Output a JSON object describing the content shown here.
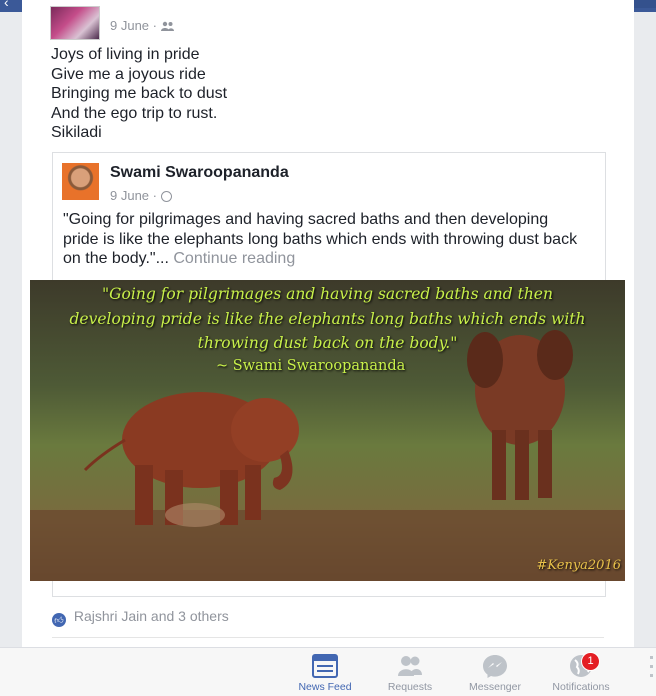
{
  "post": {
    "date": "9 June",
    "separator": "·",
    "lines": [
      "Joys of living in pride",
      "Give me a joyous ride",
      "Bringing me back to dust",
      "And the ego trip to rust.",
      "Sikiladi"
    ],
    "privacy_icon": "friends-icon"
  },
  "shared": {
    "author": "Swami Swaroopananda",
    "date": "9 June",
    "separator": "·",
    "privacy_icon": "globe-icon",
    "quote": "\"Going for pilgrimages and having sacred baths and then developing pride is like the elephants long baths which ends with throwing dust back on the body.\"...",
    "continue_label": "Continue reading"
  },
  "photo": {
    "quote_lines": [
      "\"Going for pilgrimages and having sacred baths and then",
      "developing pride is like the elephants long baths which ends with",
      "throwing dust back on the body.\""
    ],
    "author": "~ Swami Swaroopananda",
    "watermark": "#Kenya2016"
  },
  "reactions": {
    "text": "Rajshri Jain and 3 others",
    "icon": "like-icon"
  },
  "tabbar": {
    "tabs": [
      {
        "label": "News Feed",
        "icon": "news-feed-icon",
        "active": true
      },
      {
        "label": "Requests",
        "icon": "requests-icon",
        "active": false
      },
      {
        "label": "Messenger",
        "icon": "messenger-icon",
        "active": false
      },
      {
        "label": "Notifications",
        "icon": "globe-notifications-icon",
        "active": false,
        "badge": "1"
      }
    ]
  },
  "colors": {
    "brand": "#3b5998",
    "active_tab": "#4267b2",
    "badge": "#e41e24",
    "photo_text": "#c8f04a"
  }
}
